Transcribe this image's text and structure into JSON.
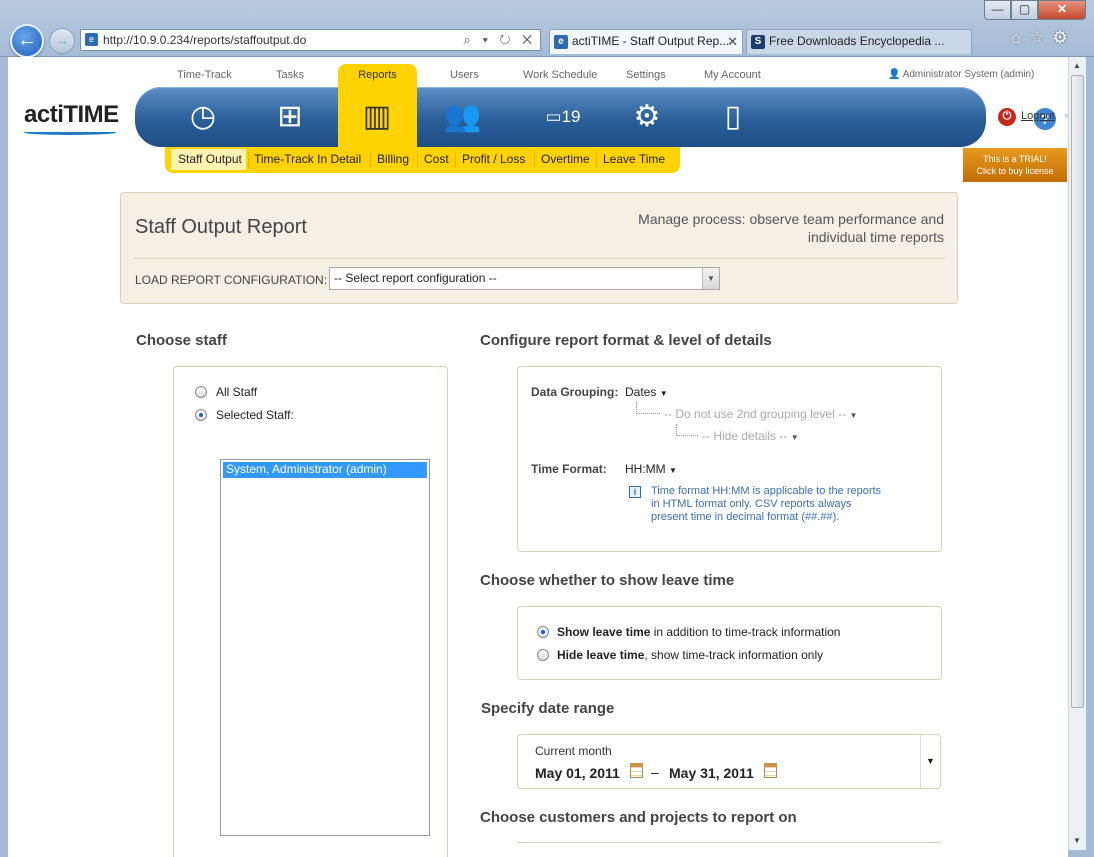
{
  "browser": {
    "url": "http://10.9.0.234/reports/staffoutput.do",
    "tabs": [
      {
        "title": "actiTIME - Staff Output Rep...",
        "favicon": "page-icon"
      },
      {
        "title": "Free Downloads Encyclopedia ...",
        "favicon": "S"
      }
    ],
    "address_tools": "⌕ ▾ ↻ ✕"
  },
  "app": {
    "logo": "actiTIME",
    "top_nav": [
      "Time-Track",
      "Tasks",
      "Reports",
      "Users",
      "Work Schedule",
      "Settings",
      "My Account"
    ],
    "user": "Administrator System (admin)",
    "logout": "Logout",
    "trial_title": "This is a TRIAL!",
    "trial_sub": "Click to buy license",
    "sub_nav": [
      "Staff Output",
      "Time-Track In Detail",
      "Billing",
      "Cost",
      "Profit / Loss",
      "Overtime",
      "Leave Time"
    ],
    "calendar_day": "19"
  },
  "report": {
    "title": "Staff Output Report",
    "description_line1": "Manage process: observe team performance and",
    "description_line2": "individual time reports",
    "load_label": "LOAD REPORT CONFIGURATION:",
    "load_value": "-- Select report configuration --"
  },
  "staff": {
    "heading": "Choose staff",
    "all_label": "All Staff",
    "selected_label": "Selected Staff:",
    "selected_option": "selected",
    "list": [
      "System, Administrator (admin)"
    ]
  },
  "format": {
    "heading": "Configure report format & level of details",
    "grouping_label": "Data Grouping:",
    "grouping_value": "Dates",
    "second_level": "-- Do not use 2nd grouping level --",
    "details": "-- Hide details --",
    "time_label": "Time Format:",
    "time_value": "HH:MM",
    "info_line1": "Time format HH:MM is applicable to the reports",
    "info_line2": "in HTML format only. CSV reports always",
    "info_line3": "present time in decimal format (##.##)."
  },
  "leave": {
    "heading": "Choose whether to show leave time",
    "show_bold": "Show leave time",
    "show_rest": " in addition to time-track information",
    "hide_bold": "Hide leave time",
    "hide_rest": ", show time-track information only",
    "selected_option": "show"
  },
  "date": {
    "heading": "Specify date range",
    "preset": "Current month",
    "from": "May 01, 2011",
    "to": "May 31, 2011",
    "dash": "–"
  },
  "customers": {
    "heading": "Choose customers and projects to report on"
  },
  "colors": {
    "accent_yellow": "#ffd200",
    "nav_blue": "#2a5f99",
    "trial_orange": "#d9850f",
    "selection_blue": "#3399ff"
  }
}
